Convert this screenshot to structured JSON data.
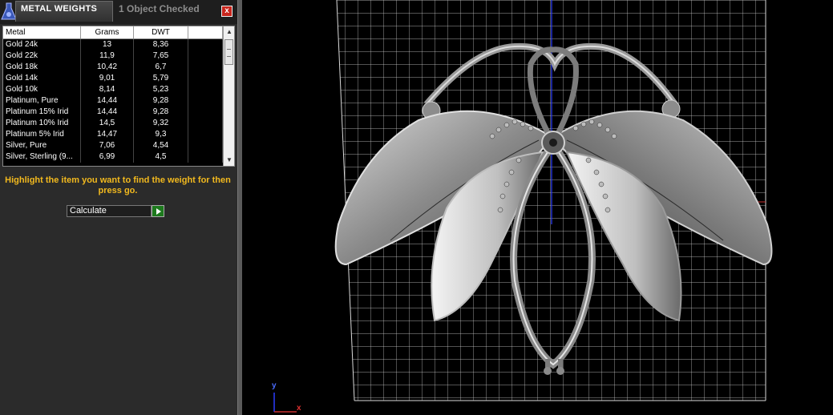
{
  "titlebar": {
    "title": "METAL WEIGHTS",
    "status": "1 Object Checked",
    "close_label": "x"
  },
  "table": {
    "headers": [
      "Metal",
      "Grams",
      "DWT"
    ],
    "rows": [
      {
        "metal": "Gold 24k",
        "grams": "13",
        "dwt": "8,36"
      },
      {
        "metal": "Gold 22k",
        "grams": "11,9",
        "dwt": "7,65"
      },
      {
        "metal": "Gold 18k",
        "grams": "10,42",
        "dwt": "6,7"
      },
      {
        "metal": "Gold 14k",
        "grams": "9,01",
        "dwt": "5,79"
      },
      {
        "metal": "Gold 10k",
        "grams": "8,14",
        "dwt": "5,23"
      },
      {
        "metal": "Platinum, Pure",
        "grams": "14,44",
        "dwt": "9,28"
      },
      {
        "metal": "Platinum 15% Irid",
        "grams": "14,44",
        "dwt": "9,28"
      },
      {
        "metal": "Platinum 10% Irid",
        "grams": "14,5",
        "dwt": "9,32"
      },
      {
        "metal": "Platinum 5% Irid",
        "grams": "14,47",
        "dwt": "9,3"
      },
      {
        "metal": "Silver, Pure",
        "grams": "7,06",
        "dwt": "4,54"
      },
      {
        "metal": "Silver, Sterling (9...",
        "grams": "6,99",
        "dwt": "4,5"
      }
    ],
    "scroll_up_icon": "▲",
    "scroll_down_icon": "▼"
  },
  "instruction": "Highlight the item you want to find the weight for then press go.",
  "calculate": {
    "value": "Calculate",
    "go_icon": "play-arrow-icon"
  },
  "viewport": {
    "axis_y_label": "y",
    "axis_x_label": "x"
  },
  "colors": {
    "accent": "#f2b91e",
    "close": "#c8251c",
    "go": "#1d7a1d",
    "axis_y": "#2a3cff",
    "axis_x": "#e03030"
  }
}
